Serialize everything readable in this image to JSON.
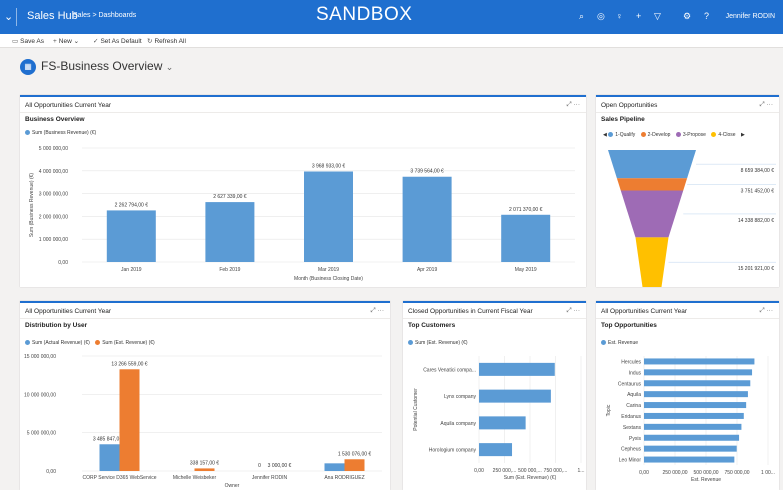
{
  "topbar": {
    "app_name": "Sales Hub",
    "breadcrumb": "Sales  >  Dashboards",
    "environment_label": "SANDBOX",
    "user_name": "Jennifer RODIN",
    "icons": [
      "search-icon",
      "target-icon",
      "lightbulb-icon",
      "plus-icon",
      "filter-icon",
      "gear-icon",
      "help-icon"
    ]
  },
  "commands": {
    "save_as": "Save As",
    "new": "New",
    "set_default": "Set As Default",
    "refresh_all": "Refresh All"
  },
  "dashboard": {
    "title": "FS-Business Overview"
  },
  "colors": {
    "brand": "#1f6fcf",
    "blue": "#5b9bd5",
    "orange": "#ed7d31",
    "purple": "#9e6bb5",
    "yellow": "#ffc000"
  },
  "cards": {
    "business_overview": {
      "title": "All Opportunities Current Year",
      "subtitle": "Business Overview"
    },
    "open_opps": {
      "title": "Open Opportunities",
      "subtitle": "Sales Pipeline"
    },
    "distribution": {
      "title": "All Opportunities Current Year",
      "subtitle": "Distribution by User"
    },
    "top_customers": {
      "title": "Closed Opportunities in Current Fiscal Year",
      "subtitle": "Top Customers"
    },
    "top_opps": {
      "title": "All Opportunities Current Year",
      "subtitle": "Top Opportunities"
    }
  },
  "chart_data": [
    {
      "type": "bar",
      "legend": [
        "Sum (Business Revenue) (€)"
      ],
      "categories": [
        "Jan 2019",
        "Feb 2019",
        "Mar 2019",
        "Apr 2019",
        "May 2019"
      ],
      "values": [
        2262794,
        2627339,
        3968933,
        3739564,
        2071370
      ],
      "value_labels": [
        "2 262 794,00 €",
        "2 627 339,00 €",
        "3 968 933,00 €",
        "3 739 564,00 €",
        "2 071 370,00 €"
      ],
      "ylim": [
        0,
        5000000
      ],
      "yticks": [
        "0,00",
        "1 000 000,00",
        "2 000 000,00",
        "3 000 000,00",
        "4 000 000,00",
        "5 000 000,00"
      ],
      "xlabel": "Month (Business Closing Date)",
      "ylabel": "Sum (Business Revenue) (€)"
    },
    {
      "type": "funnel",
      "legend": [
        "1-Qualify",
        "2-Develop",
        "3-Propose",
        "4-Close"
      ],
      "values": [
        8659384,
        3751452,
        14338882,
        15201921
      ],
      "value_labels": [
        "8 659 384,00 €",
        "3 751 452,00 €",
        "14 338 882,00 €",
        "15 201 921,00 €"
      ],
      "colors": [
        "#5b9bd5",
        "#ed7d31",
        "#9e6bb5",
        "#ffc000"
      ]
    },
    {
      "type": "bar",
      "legend": [
        "Sum (Actual Revenue) (€)",
        "Sum (Est. Revenue) (€)"
      ],
      "categories": [
        "CORP Service D365 WebService",
        "Michelle Weisbeker",
        "Jennifer RODIN",
        "Ana RODRIGUEZ"
      ],
      "series": [
        {
          "name": "Sum (Actual Revenue) (€)",
          "values": [
            3485847,
            0,
            0,
            1000000
          ],
          "labels": [
            "3 485 847,00 €",
            "",
            "0",
            ""
          ]
        },
        {
          "name": "Sum (Est. Revenue) (€)",
          "values": [
            13266559,
            338157,
            3000,
            1530076
          ],
          "labels": [
            "13 266 559,00 €",
            "338 157,00 €",
            "3 000,00 €",
            "1 530 076,00 €"
          ]
        }
      ],
      "ylim": [
        0,
        15000000
      ],
      "yticks": [
        "0,00",
        "5 000 000,00",
        "10 000 000,00",
        "15 000 000,00"
      ],
      "xlabel": "Owner"
    },
    {
      "type": "bar",
      "orientation": "horizontal",
      "legend": [
        "Sum (Est. Revenue) (€)"
      ],
      "categories": [
        "Cares Venatici compa...",
        "Lynx company",
        "Aquila company",
        "Horologium company"
      ],
      "values": [
        780000,
        740000,
        480000,
        340000
      ],
      "xticks": [
        "0,00",
        "250 000,...",
        "500 000,...",
        "750 000,...",
        "1..."
      ],
      "xlim": [
        0,
        1050000
      ],
      "xlabel": "Sum (Est. Revenue) (€)",
      "ylabel": "Potential Customer"
    },
    {
      "type": "bar",
      "orientation": "horizontal",
      "legend": [
        "Est. Revenue"
      ],
      "categories": [
        "Hercules",
        "Indus",
        "Centaurus",
        "Aquila",
        "Carina",
        "Eridanus",
        "Sextans",
        "Pyxis",
        "Cepheus",
        "Leo Minor"
      ],
      "values": [
        935000,
        915000,
        900000,
        880000,
        865000,
        845000,
        825000,
        805000,
        785000,
        765000
      ],
      "xticks": [
        "0,00",
        "250 000,00",
        "500 000,00",
        "750 000,00",
        "1 00..."
      ],
      "xlim": [
        0,
        1050000
      ],
      "xlabel": "Est. Revenue",
      "ylabel": "Topic"
    }
  ]
}
